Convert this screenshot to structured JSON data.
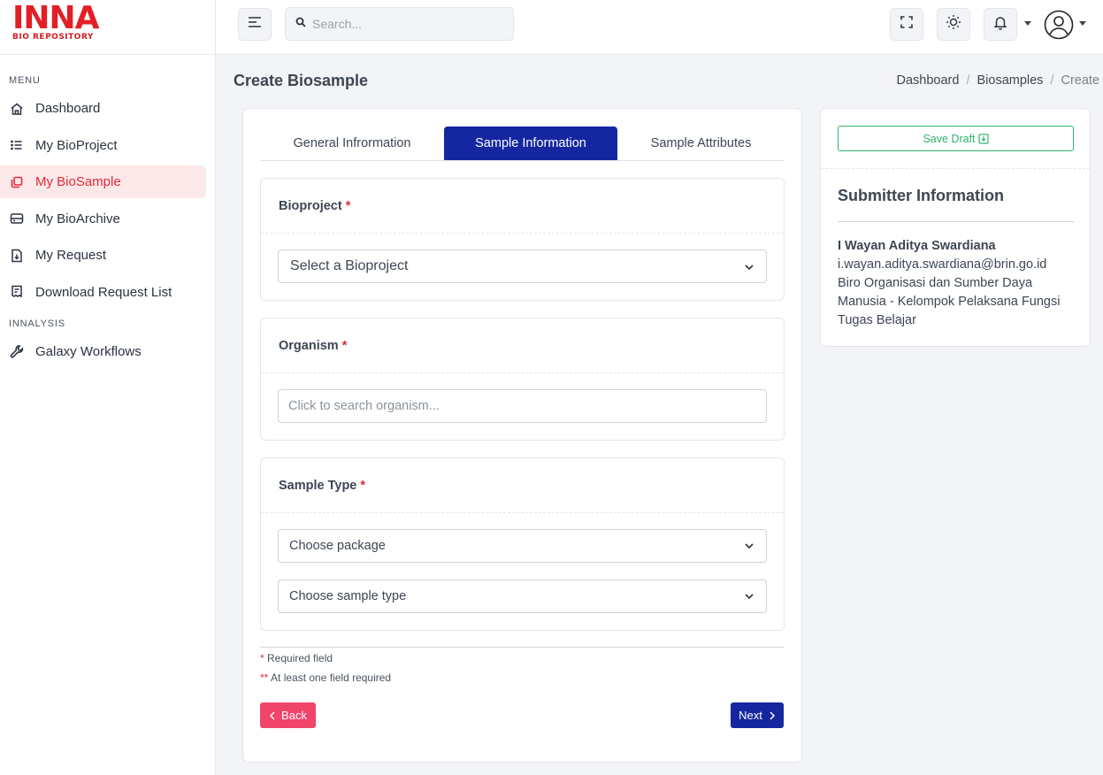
{
  "logo": {
    "main": "INNA",
    "sub": "BIO REPOSITORY"
  },
  "sidebar": {
    "heading_menu": "MENU",
    "menu_items": [
      {
        "label": "Dashboard",
        "icon": "home-icon"
      },
      {
        "label": "My BioProject",
        "icon": "list-icon"
      },
      {
        "label": "My BioSample",
        "icon": "copy-icon",
        "active": true
      },
      {
        "label": "My BioArchive",
        "icon": "server-icon"
      },
      {
        "label": "My Request",
        "icon": "file-download-icon"
      },
      {
        "label": "Download Request List",
        "icon": "receipt-icon"
      }
    ],
    "heading_innalysis": "INNALYSIS",
    "innalysis_items": [
      {
        "label": "Galaxy Workflows",
        "icon": "wrench-icon"
      }
    ]
  },
  "topbar": {
    "search_placeholder": "Search..."
  },
  "page": {
    "title": "Create Biosample",
    "breadcrumb": [
      "Dashboard",
      "Biosamples",
      "Create"
    ]
  },
  "tabs": [
    "General Infrormation",
    "Sample Information",
    "Sample Attributes"
  ],
  "form": {
    "bioproject": {
      "label": "Bioproject",
      "select_value": "Select a Bioproject"
    },
    "organism": {
      "label": "Organism",
      "placeholder": "Click to search organism..."
    },
    "sample_type": {
      "label": "Sample Type",
      "package_value": "Choose package",
      "type_value": "Choose sample type"
    },
    "required_star": "*",
    "required_note": "Required field",
    "atleast_star": "**",
    "atleast_note": "At least one field required",
    "back_label": "Back",
    "next_label": "Next"
  },
  "submitter": {
    "save_draft": "Save Draft",
    "title": "Submitter Information",
    "name": "I Wayan Aditya Swardiana",
    "email": "i.wayan.aditya.swardiana@brin.go.id",
    "org_line1": "Biro Organisasi dan Sumber Daya",
    "org_line2": "Manusia - Kelompok Pelaksana Fungsi",
    "org_line3": "Tugas Belajar"
  },
  "colors": {
    "brand_red": "#e21f26",
    "primary": "#1527a0",
    "danger": "#f0446a",
    "success": "#2fb36d"
  }
}
